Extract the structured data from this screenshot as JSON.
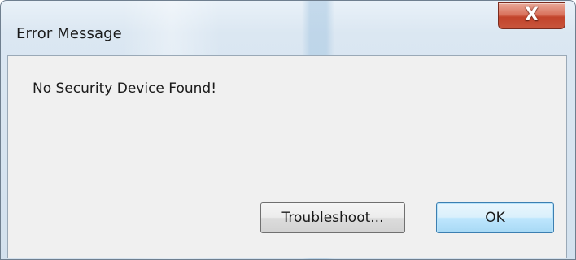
{
  "window": {
    "title": "Error Message",
    "close_glyph": "X"
  },
  "dialog": {
    "message": "No Security Device Found!",
    "buttons": {
      "troubleshoot_label": "Troubleshoot...",
      "ok_label": "OK"
    }
  },
  "colors": {
    "close_button": "#c8553c",
    "default_button_border": "#3c7fb1",
    "client_background": "#f0f0f0"
  }
}
